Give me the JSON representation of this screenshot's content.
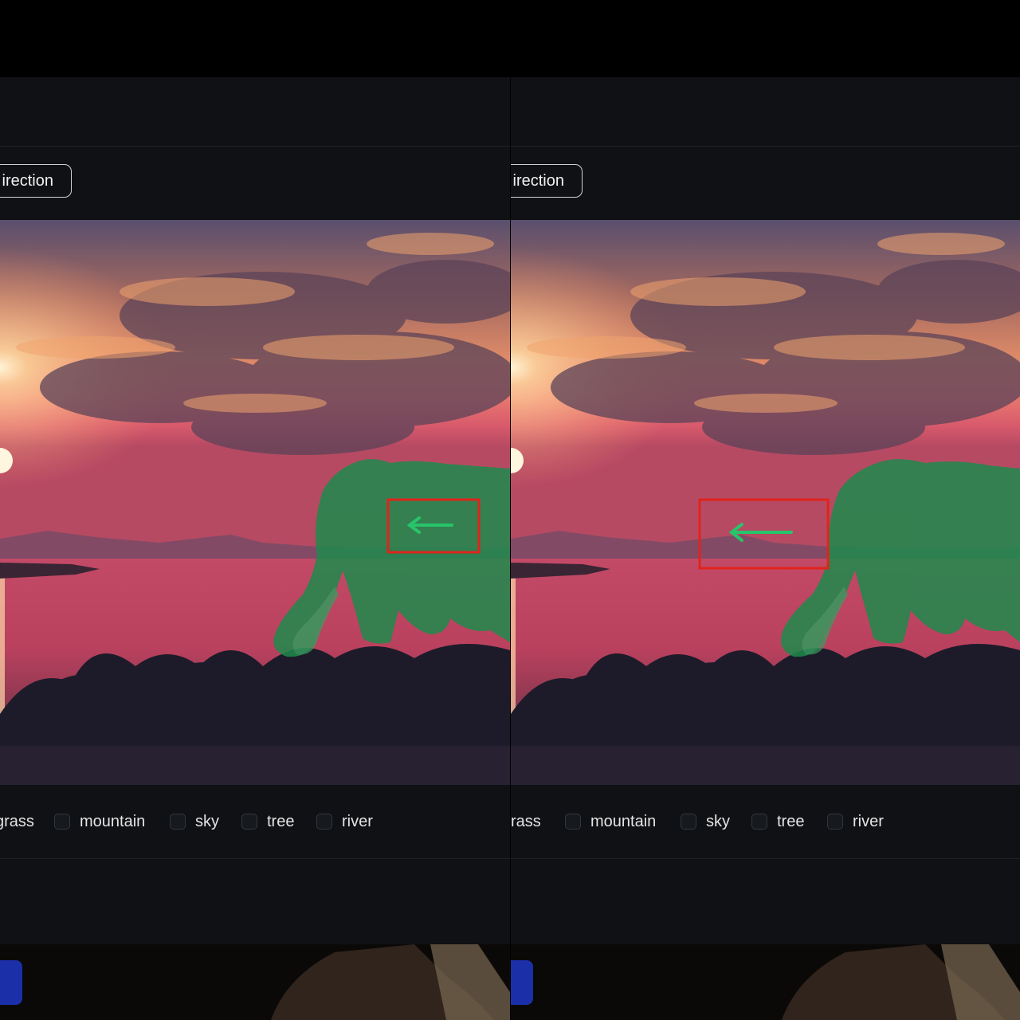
{
  "panels": [
    {
      "id": "before",
      "direction_button_label": "irection",
      "labels": [
        "grass",
        "mountain",
        "sky",
        "tree",
        "river"
      ]
    },
    {
      "id": "after",
      "direction_button_label": "irection",
      "labels": [
        "rass",
        "mountain",
        "sky",
        "tree",
        "river"
      ]
    }
  ],
  "annotations": {
    "arrow_direction": "left",
    "box_color": "#e0241b",
    "mask_color": "#1f8a4c",
    "arrow_color": "#27c46a"
  }
}
